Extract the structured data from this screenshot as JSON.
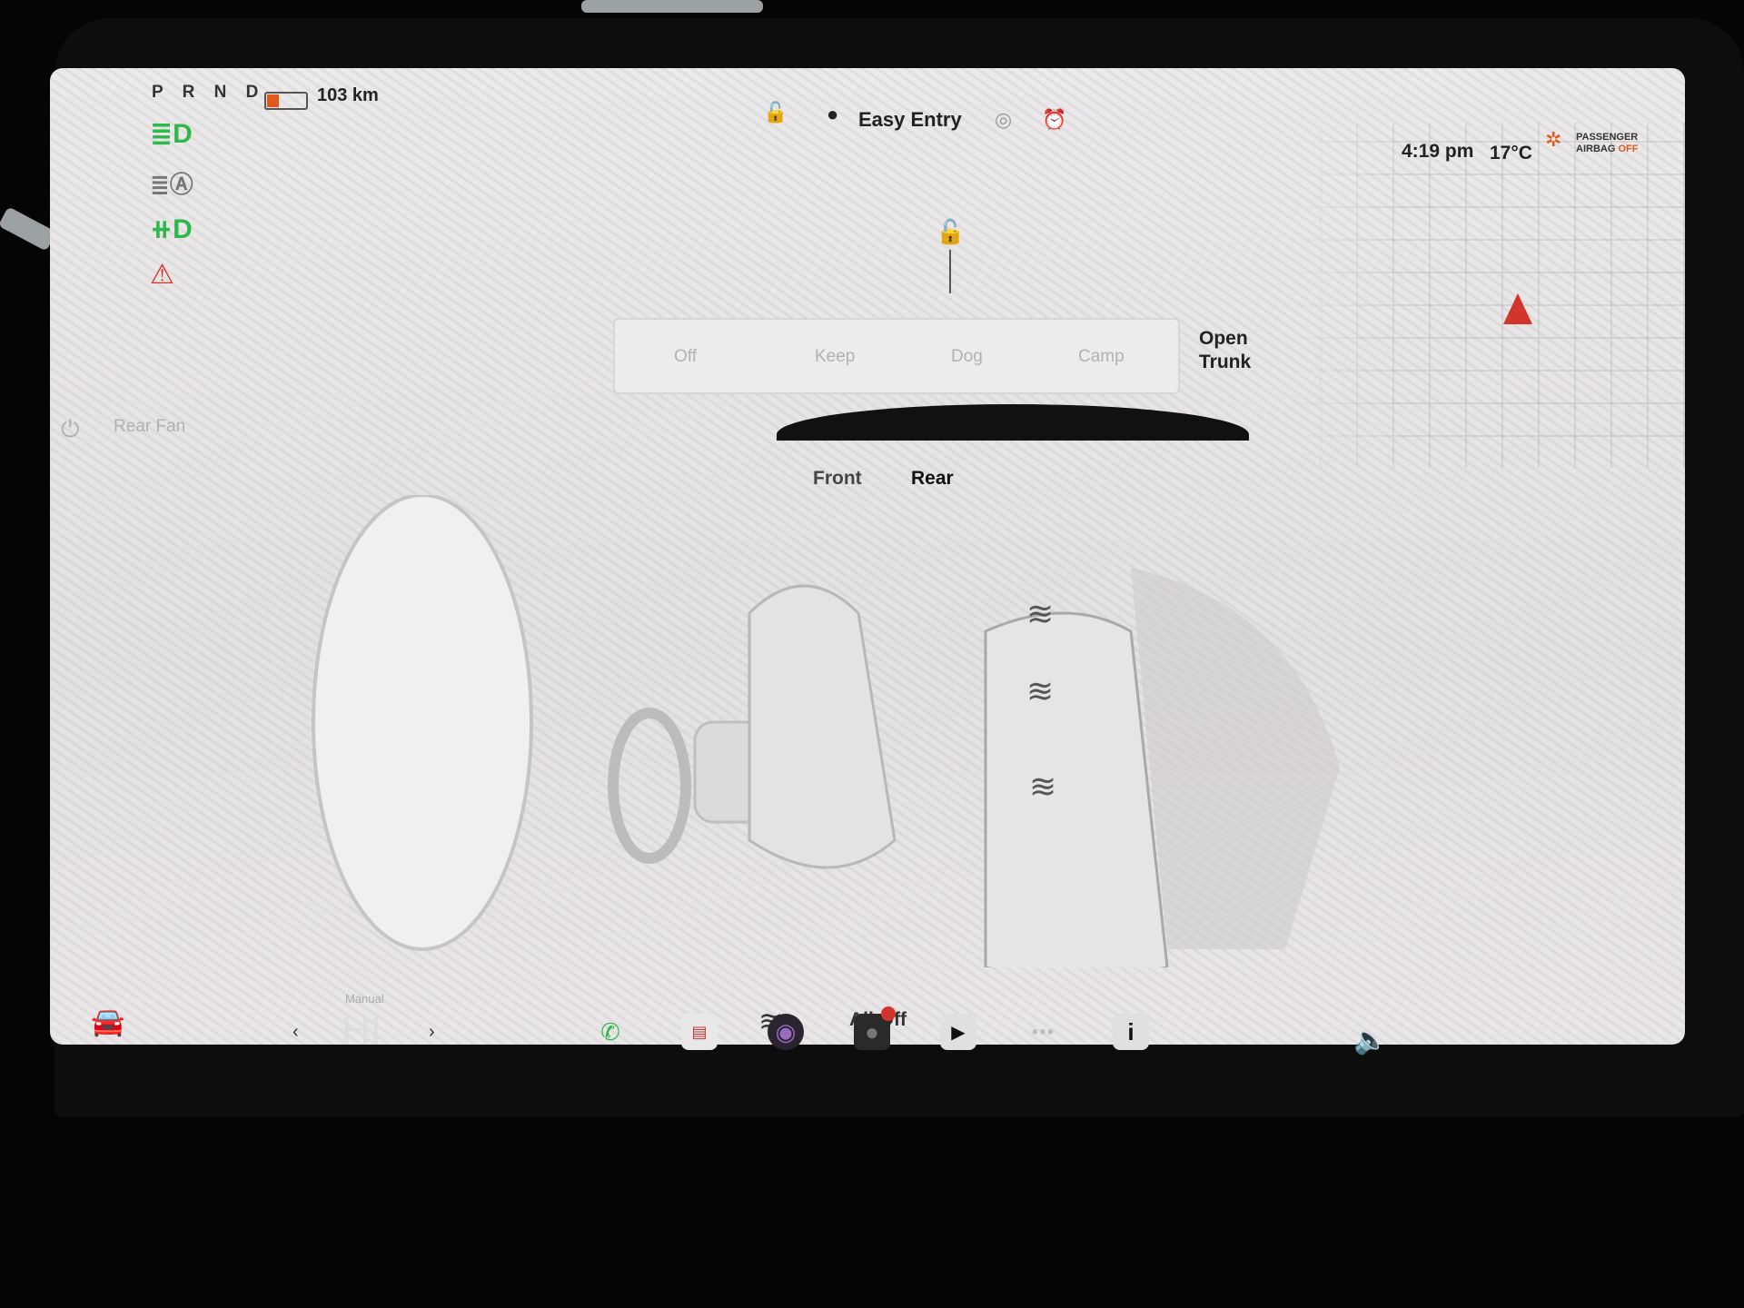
{
  "status_bar": {
    "gear": "P R N D",
    "range": "103 km",
    "battery_level": 0.3,
    "time": "4:19 pm",
    "outside_temp": "17°C",
    "driver_profile": "Easy Entry",
    "airbag_line1": "PASSENGER",
    "airbag_line2": "AIRBAG",
    "airbag_status": "OFF"
  },
  "indicators": [
    "headlights-icon",
    "auto-highbeam-icon",
    "fog-light-icon",
    "seatbelt-warning-icon"
  ],
  "trunk": {
    "label_line1": "Open",
    "label_line2": "Trunk"
  },
  "fan_modes": [
    "Off",
    "Keep",
    "Dog",
    "Camp"
  ],
  "rear_fan_label": "Rear Fan",
  "seat_tabs": {
    "front": "Front",
    "rear": "Rear",
    "selected": "Rear"
  },
  "seat_heaters": [
    "rear-left",
    "rear-center",
    "rear-right"
  ],
  "all_off_label": "All Off",
  "climate": {
    "mode_label": "Manual",
    "temperature": "HI"
  },
  "colors": {
    "accent": "#e05a1c",
    "nav_arrow": "#d2362a",
    "phone": "#2fb84a"
  },
  "dock_icons": [
    "phone-icon",
    "calendar-icon",
    "camera-icon",
    "dashcam-icon",
    "media-icon",
    "more-icon",
    "manual-icon",
    "volume-icon"
  ]
}
